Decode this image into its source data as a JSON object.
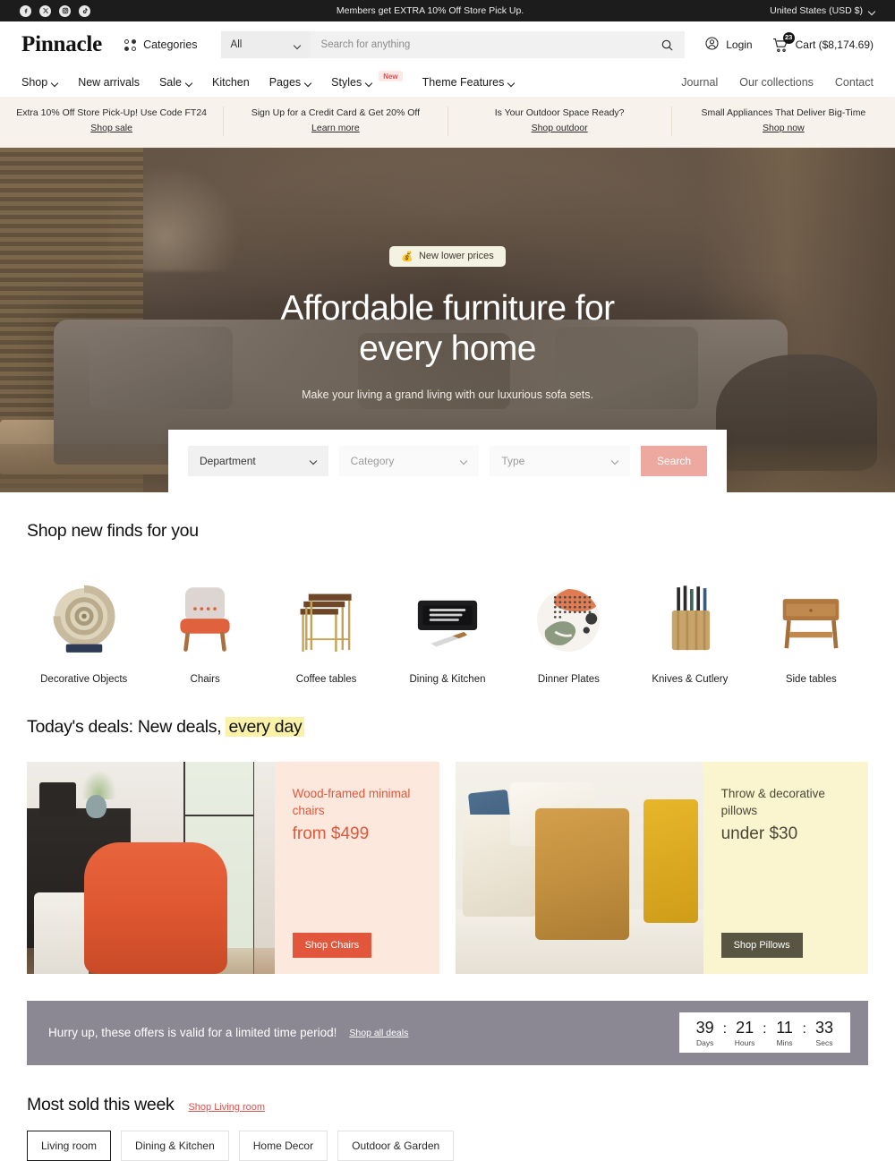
{
  "topbar": {
    "social": [
      {
        "name": "facebook-icon",
        "glyph": "f"
      },
      {
        "name": "x-icon",
        "glyph": "✕"
      },
      {
        "name": "instagram-icon",
        "glyph": "◎"
      },
      {
        "name": "tiktok-icon",
        "glyph": "♪"
      }
    ],
    "message": "Members get EXTRA 10% Off Store Pick Up.",
    "country": "United States (USD $)"
  },
  "header": {
    "logo": "Pinnacle",
    "categories_label": "Categories",
    "search": {
      "scope": "All",
      "placeholder": "Search for anything",
      "value": ""
    },
    "login_label": "Login",
    "cart_label": "Cart ($8,174.69)",
    "cart_count": "23"
  },
  "nav": {
    "left": [
      {
        "label": "Shop",
        "caret": true,
        "badge": ""
      },
      {
        "label": "New arrivals",
        "caret": false,
        "badge": ""
      },
      {
        "label": "Sale",
        "caret": true,
        "badge": ""
      },
      {
        "label": "Kitchen",
        "caret": false,
        "badge": ""
      },
      {
        "label": "Pages",
        "caret": true,
        "badge": ""
      },
      {
        "label": "Styles",
        "caret": true,
        "badge": "New"
      },
      {
        "label": "Theme Features",
        "caret": true,
        "badge": ""
      }
    ],
    "right": [
      "Journal",
      "Our collections",
      "Contact"
    ]
  },
  "promos": [
    {
      "text": "Extra 10% Off Store Pick-Up! Use Code FT24",
      "link": "Shop sale"
    },
    {
      "text": "Sign Up for a Credit Card & Get 20% Off",
      "link": "Learn more"
    },
    {
      "text": "Is Your Outdoor Space Ready?",
      "link": "Shop outdoor"
    },
    {
      "text": "Small Appliances That Deliver Big-Time",
      "link": "Shop now"
    }
  ],
  "hero": {
    "badge_icon": "💰",
    "badge": "New lower prices",
    "title": "Affordable furniture for every home",
    "subtitle": "Make your living a grand living with our luxurious sofa sets.",
    "finder": {
      "department": "Department",
      "category": "Category",
      "type": "Type",
      "search_label": "Search"
    }
  },
  "new_finds": {
    "title": "Shop new finds for you",
    "items": [
      {
        "label": "Decorative Objects"
      },
      {
        "label": "Chairs"
      },
      {
        "label": "Coffee tables"
      },
      {
        "label": "Dining & Kitchen"
      },
      {
        "label": "Dinner Plates"
      },
      {
        "label": "Knives & Cutlery"
      },
      {
        "label": "Side tables"
      }
    ]
  },
  "deals": {
    "title_plain": "Today's deals: New deals, ",
    "title_highlight": "every day",
    "cards": [
      {
        "heading": "Wood-framed minimal chairs",
        "price": "from $499",
        "button": "Shop Chairs",
        "accent": "#e2563b",
        "bg": "#fde8dd"
      },
      {
        "heading": "Throw & decorative pillows",
        "price": "under $30",
        "button": "Shop Pillows",
        "accent": "#4a4738",
        "bg": "#fbf5cf"
      }
    ]
  },
  "countdown": {
    "message": "Hurry up, these offers is valid for a limited time period!",
    "link": "Shop all deals",
    "units": [
      {
        "value": "39",
        "label": "Days"
      },
      {
        "value": "21",
        "label": "Hours"
      },
      {
        "value": "11",
        "label": "Mins"
      },
      {
        "value": "33",
        "label": "Secs"
      }
    ]
  },
  "most_sold": {
    "title": "Most sold this week",
    "link": "Shop Living room",
    "tabs": [
      "Living room",
      "Dining & Kitchen",
      "Home Decor",
      "Outdoor & Garden"
    ],
    "active_tab": "Living room"
  },
  "colors": {
    "topbar_bg": "#1c1c1c",
    "promo_bg": "#f7f3ec",
    "accent_red": "#e2563b",
    "search_btn": "#eda9a0",
    "countdown_bg": "#8b8894",
    "highlight": "#fbf2a9"
  }
}
